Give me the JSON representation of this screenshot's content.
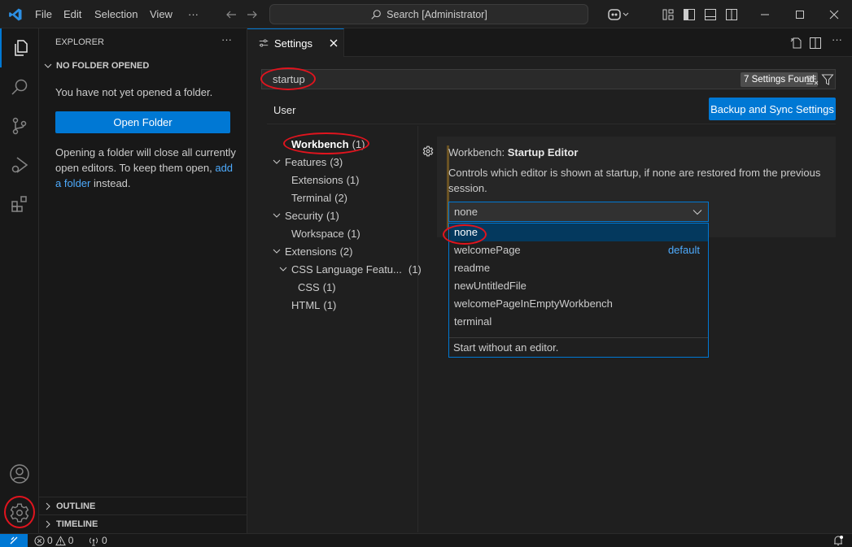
{
  "titlebar": {
    "menu": [
      "File",
      "Edit",
      "Selection",
      "View"
    ],
    "more": "···",
    "search_placeholder": "Search [Administrator]"
  },
  "activitybar": {
    "items": [
      "explorer",
      "search",
      "source-control",
      "run-and-debug",
      "extensions"
    ],
    "bottom": [
      "accounts",
      "manage"
    ]
  },
  "sidebar": {
    "title": "EXPLORER",
    "more": "···",
    "section": "NO FOLDER OPENED",
    "message": "You have not yet opened a folder.",
    "open_folder_button": "Open Folder",
    "info_pre": "Opening a folder will close all currently open editors. To keep them open, ",
    "info_link": "add a folder",
    "info_post": " instead.",
    "outline": "OUTLINE",
    "timeline": "TIMELINE"
  },
  "editor": {
    "tab_label": "Settings",
    "search_value": "startup",
    "found_badge": "7 Settings Found",
    "scope_tab": "User",
    "sync_button": "Backup and Sync Settings",
    "toc": [
      {
        "label": "Workbench",
        "count": "(1)",
        "level": 0,
        "bold": true,
        "chevron": false
      },
      {
        "label": "Features",
        "count": "(3)",
        "level": 0,
        "chevron": true
      },
      {
        "label": "Extensions",
        "count": "(1)",
        "level": 1,
        "chevron": false
      },
      {
        "label": "Terminal",
        "count": "(2)",
        "level": 1,
        "chevron": false
      },
      {
        "label": "Security",
        "count": "(1)",
        "level": 0,
        "chevron": true
      },
      {
        "label": "Workspace",
        "count": "(1)",
        "level": 1,
        "chevron": false
      },
      {
        "label": "Extensions",
        "count": "(2)",
        "level": 0,
        "chevron": true
      },
      {
        "label": "CSS Language Featu...",
        "count": "(1)",
        "level": 1,
        "chevron": true
      },
      {
        "label": "CSS",
        "count": "(1)",
        "level": 2,
        "chevron": false
      },
      {
        "label": "HTML",
        "count": "(1)",
        "level": 1,
        "chevron": false
      }
    ],
    "setting": {
      "category": "Workbench: ",
      "name": "Startup Editor",
      "description": "Controls which editor is shown at startup, if none are restored from the previous session.",
      "value": "none",
      "options": [
        "none",
        "welcomePage",
        "readme",
        "newUntitledFile",
        "welcomePageInEmptyWorkbench",
        "terminal"
      ],
      "default_option_index": 1,
      "default_label": "default",
      "selected_option_index": 0,
      "option_description": "Start without an editor."
    }
  },
  "statusbar": {
    "errors": "0",
    "warnings": "0",
    "ports": "0"
  },
  "colors": {
    "accent": "#0078d4",
    "link": "#4daafc",
    "selected_option": "#04395e",
    "annotation_red": "#e0141e"
  }
}
